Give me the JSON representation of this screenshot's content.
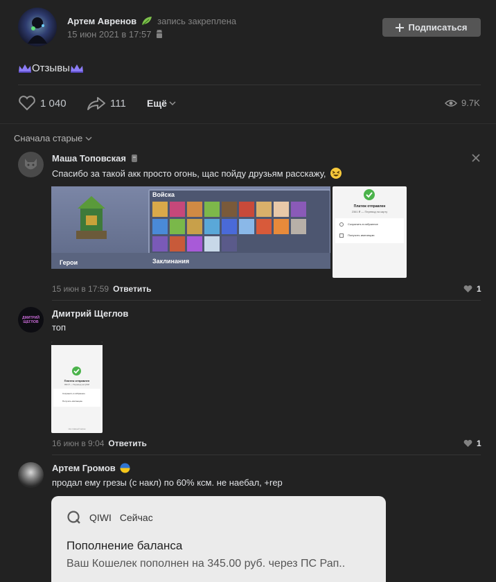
{
  "post": {
    "author": "Артем Авренов",
    "pinned_label": "запись закреплена",
    "date": "15 июн 2021 в 17:57",
    "subscribe_label": "Подписаться",
    "text": "Отзывы"
  },
  "actions": {
    "likes": "1 040",
    "shares": "111",
    "more_label": "Ещё",
    "views": "9.7K"
  },
  "sort_label": "Сначала старые",
  "comments": [
    {
      "author": "Маша Топовская",
      "text": "Спасибо за такой акк просто огонь, щас пойду друзьям расскажу,",
      "date": "15 июн в 17:59",
      "reply_label": "Ответить",
      "likes": "1",
      "game_image": {
        "troops_label": "Войска",
        "heroes_label": "Герои",
        "spells_label": "Заклинания"
      },
      "payment_image": {
        "title": "Платеж отправлен",
        "subtitle": "2361 ₽ — Перевод на карту",
        "row1": "Сохранить в избранное",
        "row2": "Получить квитанцию"
      }
    },
    {
      "author": "Дмитрий Щеглов",
      "text": "топ",
      "date": "16 июн в 9:04",
      "reply_label": "Ответить",
      "likes": "1",
      "avatar_text": "ДМИТРИЙ ЩЕГЛОВ",
      "payment_image": {
        "title": "Платеж отправлен",
        "subtitle": "999 ₽ — Перевод на QIWI",
        "row1": "Сохранить в избранное",
        "row2": "Получить квитанцию",
        "footer": "На главный экран"
      }
    },
    {
      "author": "Артем Громов",
      "text": "продал ему грезы (с накл) по 60% ксм. не наебал, +rep",
      "notification": {
        "app": "QIWI",
        "time": "Сейчас",
        "title": "Пополнение баланса",
        "body": "Ваш Кошелек пополнен на 345.00 руб. через ПС Рап.."
      }
    }
  ],
  "colors": {
    "background": "#222222",
    "text": "#e1e3e6",
    "muted": "#828282",
    "button": "#555555",
    "success": "#4bb34b"
  }
}
